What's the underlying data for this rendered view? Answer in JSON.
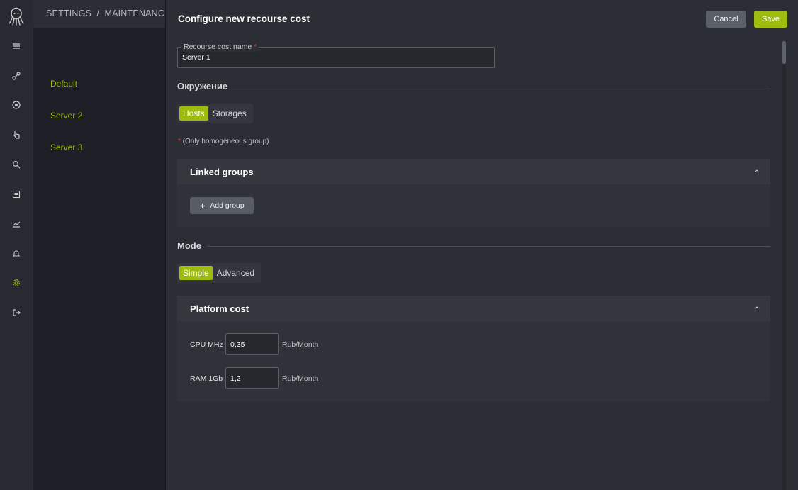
{
  "breadcrumb": "SETTINGS  /  MAINTENANCE  /",
  "nav_rail": {
    "icons": [
      "octopus-logo-icon",
      "layers-icon",
      "share-icon",
      "target-icon",
      "pointer-icon",
      "search-icon",
      "list-icon",
      "chart-icon",
      "bell-icon",
      "gear-icon",
      "logout-icon"
    ],
    "active": "gear-icon",
    "accent": "#9cbd10"
  },
  "subnav": {
    "items": [
      {
        "label": "Default"
      },
      {
        "label": "Server 2"
      },
      {
        "label": "Server 3"
      }
    ]
  },
  "panel": {
    "title": "Configure new recourse cost",
    "cancel_label": "Cancel",
    "save_label": "Save",
    "name_field": {
      "label": "Recourse cost name",
      "required_mark": "*",
      "value": "Server 1"
    },
    "environment": {
      "title": "Окружение",
      "options": [
        "Hosts",
        "Storages"
      ],
      "selected": "Hosts"
    },
    "hint": {
      "mark": "*",
      "text": "(Only homogeneous group)"
    },
    "linked_groups": {
      "title": "Linked groups",
      "add_label": "Add group"
    },
    "mode": {
      "title": "Mode",
      "options": [
        "Simple",
        "Advanced"
      ],
      "selected": "Simple"
    },
    "platform_cost": {
      "title": "Platform cost",
      "rows": [
        {
          "label": "CPU MHz",
          "value": "0,35",
          "unit": "Rub/Month"
        },
        {
          "label": "RAM 1Gb",
          "value": "1,2",
          "unit": "Rub/Month"
        }
      ]
    }
  }
}
